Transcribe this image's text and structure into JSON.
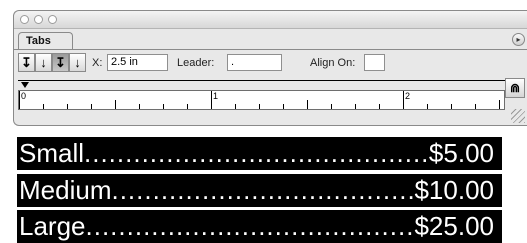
{
  "palette": {
    "tab_label": "Tabs",
    "tab_buttons": [
      {
        "icon": "left-justified-tab-icon",
        "glyph": "↧",
        "pressed": false
      },
      {
        "icon": "center-justified-tab-icon",
        "glyph": "↓",
        "pressed": false
      },
      {
        "icon": "right-justified-tab-icon",
        "glyph": "↧",
        "pressed": true
      },
      {
        "icon": "align-to-decimal-tab-icon",
        "glyph": "↓",
        "pressed": false
      }
    ],
    "x_label": "X:",
    "x_value": "2.5 in",
    "leader_label": "Leader:",
    "leader_value": ".",
    "align_on_label": "Align On:",
    "align_on_value": "",
    "flyout_glyph": "▸",
    "magnet_glyph": "⋒",
    "ruler_labels": [
      "0",
      "1",
      "2"
    ]
  },
  "lines": [
    {
      "name": "Small",
      "price": "$5.00"
    },
    {
      "name": "Medium",
      "price": "$10.00"
    },
    {
      "name": "Large",
      "price": "$25.00"
    }
  ]
}
